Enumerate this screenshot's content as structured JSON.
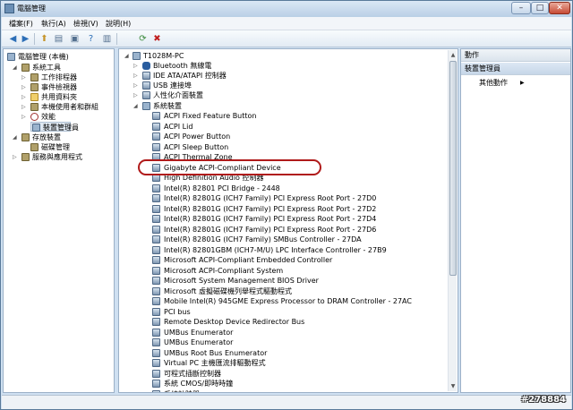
{
  "window": {
    "title": "電腦管理",
    "minimize": "–",
    "maximize": "□",
    "close": "✕"
  },
  "menu": [
    "檔案(F)",
    "執行(A)",
    "檢視(V)",
    "說明(H)"
  ],
  "toolbar_icons": [
    "back-icon",
    "forward-icon",
    "up-icon",
    "show-hide-tree-icon",
    "properties-icon",
    "help-icon",
    "action-icon",
    "scan-hardware-icon",
    "uninstall-icon"
  ],
  "left_tree": [
    {
      "label": "電腦管理 (本機)",
      "indent": 0,
      "icon": "computer"
    },
    {
      "label": "系統工具",
      "indent": 1,
      "icon": "tool"
    },
    {
      "label": "工作排程器",
      "indent": 2,
      "icon": "tool"
    },
    {
      "label": "事件檢視器",
      "indent": 2,
      "icon": "tool"
    },
    {
      "label": "共用資料夾",
      "indent": 2,
      "icon": "folder"
    },
    {
      "label": "本機使用者和群組",
      "indent": 2,
      "icon": "tool"
    },
    {
      "label": "效能",
      "indent": 2,
      "icon": "tool"
    },
    {
      "label": "裝置管理員",
      "indent": 2,
      "icon": "computer",
      "selected": true
    },
    {
      "label": "存放裝置",
      "indent": 1,
      "icon": "tool"
    },
    {
      "label": "磁碟管理",
      "indent": 2,
      "icon": "tool"
    },
    {
      "label": "服務與應用程式",
      "indent": 1,
      "icon": "tool"
    }
  ],
  "device_tree": {
    "root": "T1028M-PC",
    "categories": [
      "Bluetooth 無線電",
      "IDE ATA/ATAPI 控制器",
      "USB 連接埠",
      "人性化介面裝置"
    ],
    "expanded_category": "系統裝置",
    "devices": [
      "ACPI Fixed Feature Button",
      "ACPI Lid",
      "ACPI Power Button",
      "ACPI Sleep Button",
      "ACPI Thermal Zone",
      "Gigabyte ACPI-Compliant Device",
      "High Definition Audio 控制器",
      "Intel(R) 82801 PCI Bridge - 2448",
      "Intel(R) 82801G (ICH7 Family) PCI Express Root Port - 27D0",
      "Intel(R) 82801G (ICH7 Family) PCI Express Root Port - 27D2",
      "Intel(R) 82801G (ICH7 Family) PCI Express Root Port - 27D4",
      "Intel(R) 82801G (ICH7 Family) PCI Express Root Port - 27D6",
      "Intel(R) 82801G (ICH7 Family) SMBus Controller - 27DA",
      "Intel(R) 82801GBM (ICH7-M/U) LPC Interface Controller - 27B9",
      "Microsoft ACPI-Compliant Embedded Controller",
      "Microsoft ACPI-Compliant System",
      "Microsoft System Management BIOS Driver",
      "Microsoft 虛擬磁碟機列舉程式驅動程式",
      "Mobile Intel(R) 945GME Express Processor to DRAM Controller - 27AC",
      "PCI bus",
      "Remote Desktop Device Redirector Bus",
      "UMBus Enumerator",
      "UMBus Enumerator",
      "UMBus Root Bus Enumerator",
      "Virtual PC 主機匯流排驅動程式",
      "可程式插斷控制器",
      "系統 CMOS/即時時鐘",
      "系統計時器"
    ]
  },
  "actions": {
    "header": "動作",
    "section": "裝置管理員",
    "more": "其他動作"
  },
  "watermark": "#278884"
}
